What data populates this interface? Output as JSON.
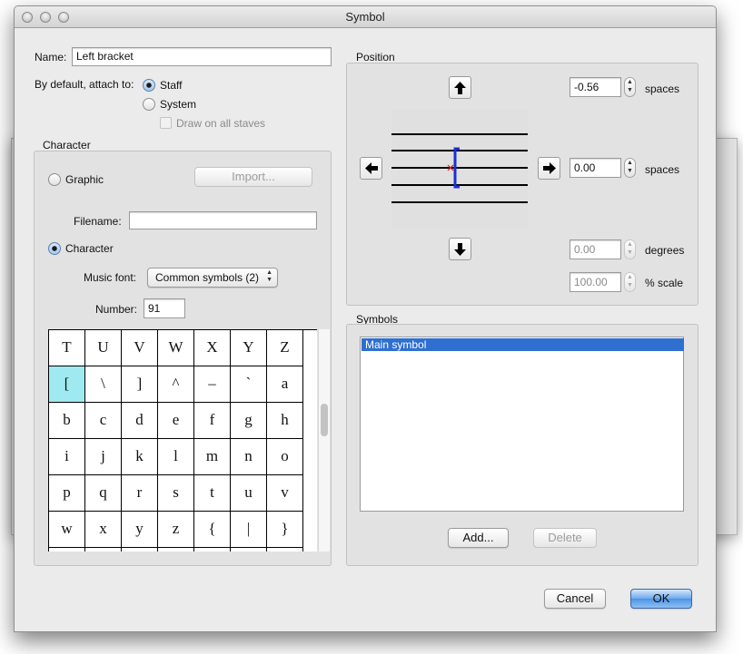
{
  "window_title": "Symbol",
  "name_field": {
    "label": "Name:",
    "value": "Left bracket"
  },
  "attach": {
    "label": "By default, attach to:",
    "options": [
      "Staff",
      "System"
    ],
    "selected": "Staff",
    "draw_on_all_staves": "Draw on all staves"
  },
  "character_group": {
    "title": "Character",
    "graphic_label": "Graphic",
    "import_button": "Import...",
    "filename_label": "Filename:",
    "filename_value": "",
    "character_label": "Character",
    "music_font_label": "Music font:",
    "music_font_value": "Common symbols (2)",
    "number_label": "Number:",
    "number_value": "91"
  },
  "char_grid": {
    "rows": [
      [
        "T",
        "U",
        "V",
        "W",
        "X",
        "Y",
        "Z"
      ],
      [
        "[",
        "\\",
        "]",
        "^",
        "–",
        "`",
        "a"
      ],
      [
        "b",
        "c",
        "d",
        "e",
        "f",
        "g",
        "h"
      ],
      [
        "i",
        "j",
        "k",
        "l",
        "m",
        "n",
        "o"
      ],
      [
        "p",
        "q",
        "r",
        "s",
        "t",
        "u",
        "v"
      ],
      [
        "w",
        "x",
        "y",
        "z",
        "{",
        "|",
        "}"
      ],
      [
        "",
        "",
        "",
        "",
        "",
        "",
        ""
      ]
    ],
    "selected": "["
  },
  "position": {
    "title": "Position",
    "vertical": {
      "value": "-0.56",
      "unit": "spaces"
    },
    "horizontal": {
      "value": "0.00",
      "unit": "spaces"
    },
    "rotation": {
      "value": "0.00",
      "unit": "degrees"
    },
    "scale": {
      "value": "100.00",
      "unit": "% scale"
    }
  },
  "symbols_group": {
    "title": "Symbols",
    "items": [
      "Main symbol"
    ],
    "add_button": "Add...",
    "delete_button": "Delete"
  },
  "buttons": {
    "cancel": "Cancel",
    "ok": "OK"
  },
  "colors": {
    "selection": "#2f6fd0",
    "selected_cell": "#9fe9f0",
    "bracket": "#1a2fd8",
    "marker": "#e02020"
  },
  "icons": [
    "arrow-up-icon",
    "arrow-down-icon",
    "arrow-left-icon",
    "arrow-right-icon",
    "stepper-icon"
  ]
}
